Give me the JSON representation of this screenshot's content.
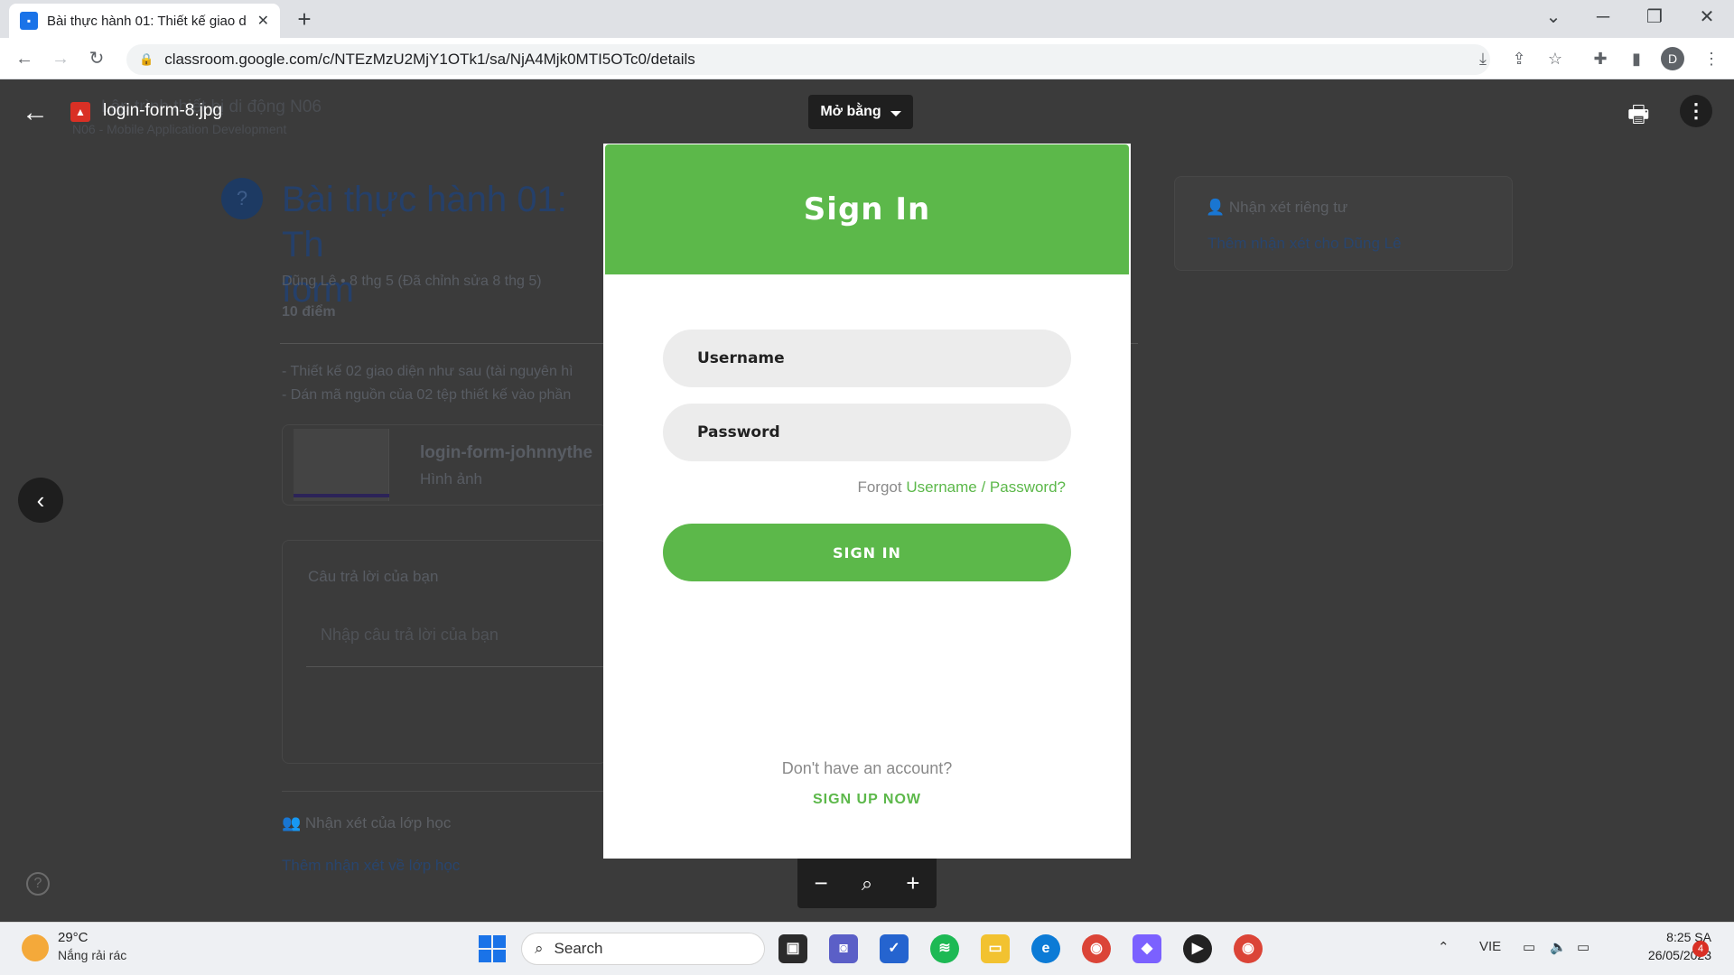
{
  "browser": {
    "tab_title": "Bài thực hành 01: Thiết kế giao d",
    "url": "classroom.google.com/c/NTEzMzU2MjY1OTk1/sa/NjA4Mjk0MTI5OTc0/details",
    "profile_initial": "D"
  },
  "background_page": {
    "class_title": "Lập trình thiết bị di động N06",
    "class_subtitle": "N06 - Mobile Application Development",
    "assignment_title": "Bài thực hành 01: Th",
    "assignment_title_2": "form",
    "meta": "Dũng Lê • 8 thg 5 (Đã chỉnh sửa 8 thg 5)",
    "points": "10 điểm",
    "desc_line_1": "- Thiết kế 02 giao diện như sau (tài nguyên hì",
    "desc_line_2": "- Dán mã nguồn của 02 tệp thiết kế vào phần",
    "attachment_name": "login-form-johnnythe",
    "attachment_type": "Hình ảnh",
    "your_answer_label": "Câu trả lời của bạn",
    "answer_placeholder": "Nhập câu trả lời của bạn",
    "class_comments_label": "Nhận xét của lớp học",
    "add_class_comment": "Thêm nhận xét về lớp học",
    "private_comments_label": "Nhận xét riêng tư",
    "add_private_comment": "Thêm nhận xét cho Dũng Lê"
  },
  "viewer": {
    "filename": "login-form-8.jpg",
    "open_with": "Mở bằng"
  },
  "preview": {
    "title": "Sign In",
    "username_placeholder": "Username",
    "password_placeholder": "Password",
    "forgot_prefix": "Forgot ",
    "forgot_link": "Username / Password?",
    "signin_button": "SIGN IN",
    "no_account": "Don't have an account?",
    "signup_link": "SIGN UP NOW",
    "accent_color": "#5cb84a"
  },
  "taskbar": {
    "weather_temp": "29°C",
    "weather_desc": "Nắng rải rác",
    "search_label": "Search",
    "language": "VIE",
    "time": "8:25 SA",
    "date": "26/05/2023",
    "notification_count": "4"
  }
}
